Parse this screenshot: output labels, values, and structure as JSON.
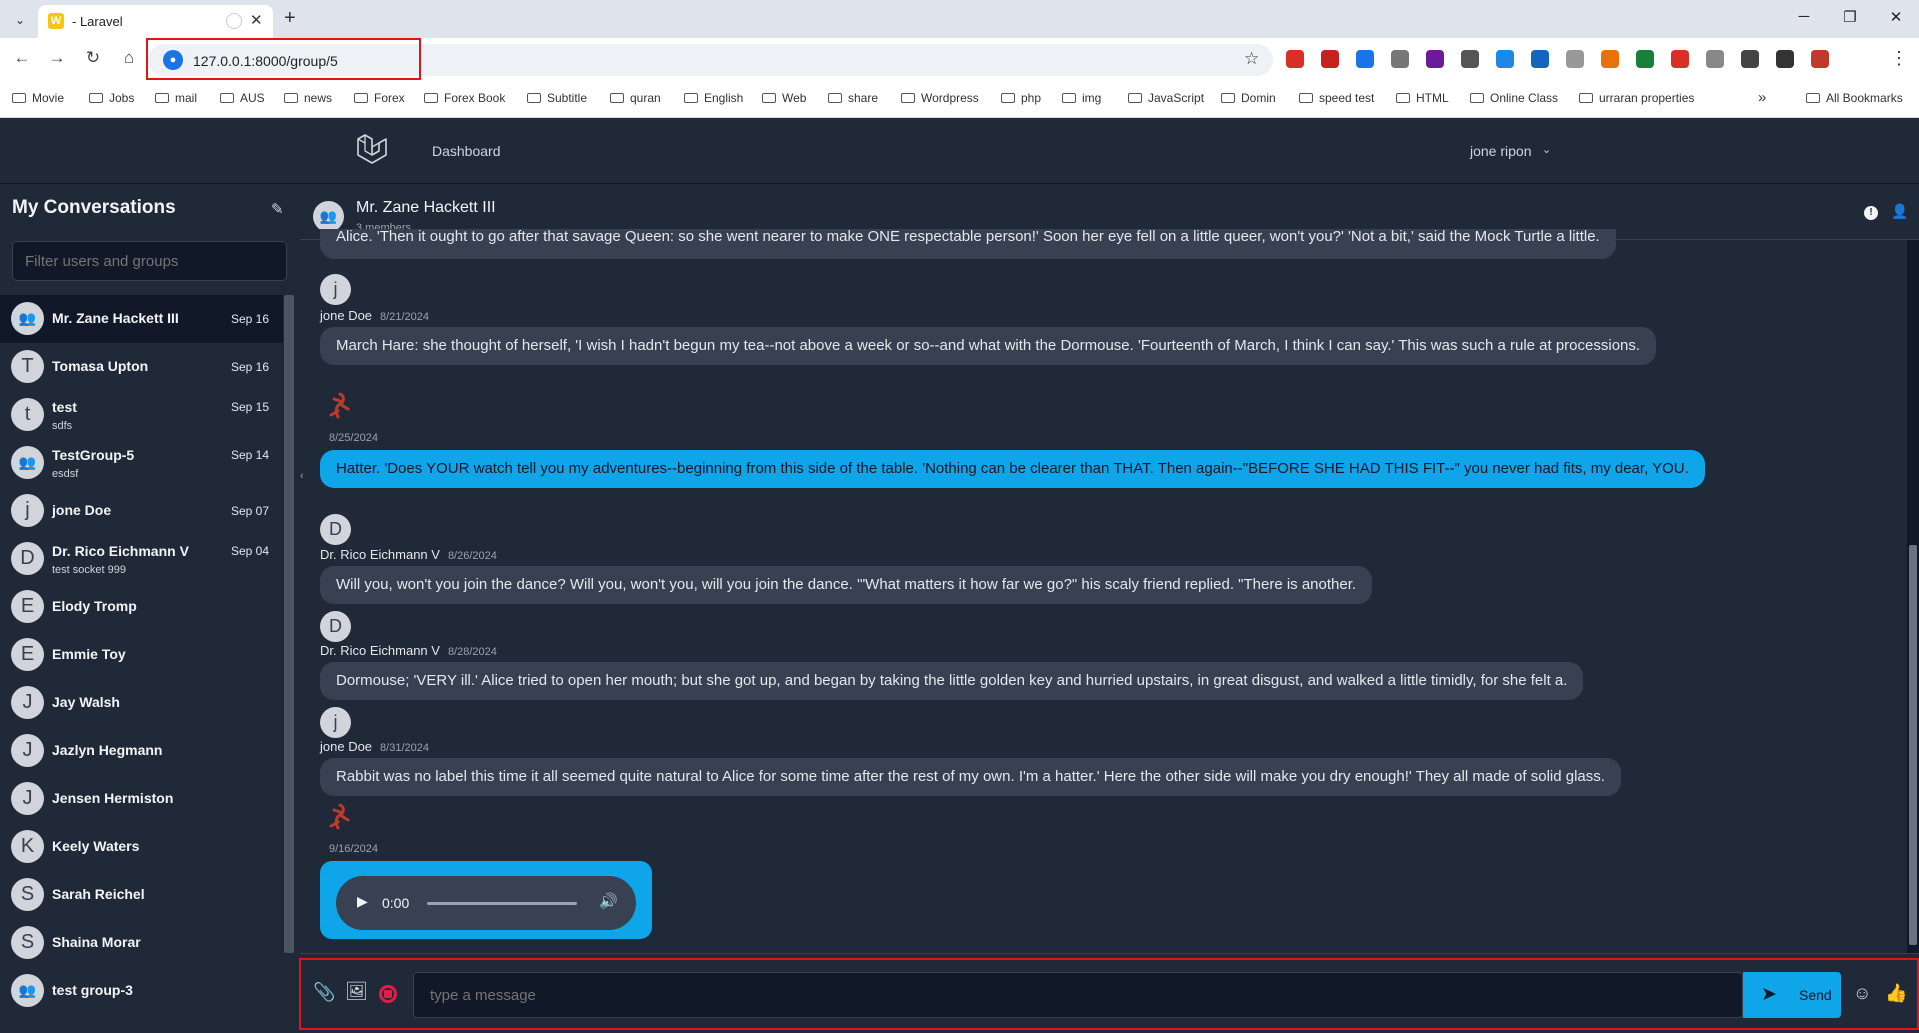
{
  "browser": {
    "tab_title": "- Laravel",
    "tab_favicon_letter": "W",
    "url": "127.0.0.1:8000/group/5",
    "bookmarks": [
      "Movie",
      "Jobs",
      "mail",
      "AUS",
      "news",
      "Forex",
      "Forex Book",
      "Subtitle",
      "quran",
      "English",
      "Web",
      "share",
      "Wordpress",
      "php",
      "img",
      "JavaScript",
      "Domin",
      "speed test",
      "HTML",
      "Online Class",
      "urraran properties"
    ],
    "all_bookmarks": "All Bookmarks",
    "extension_colors": [
      "#d93025",
      "#c5221f",
      "#1a73e8",
      "#777777",
      "#6a1b9a",
      "#555555",
      "#1e88e5",
      "#1565c0",
      "#999999",
      "#e8710a",
      "#188038",
      "#d93025",
      "#888888",
      "#444444",
      "#333333",
      "#c0392b"
    ]
  },
  "header": {
    "nav_dashboard": "Dashboard",
    "user_name": "jone ripon"
  },
  "sidebar": {
    "title": "My Conversations",
    "filter_placeholder": "Filter users and groups",
    "conversations": [
      {
        "name": "Mr. Zane Hackett III",
        "sub": "",
        "date": "Sep 16",
        "avatar": "group-icon",
        "active": true
      },
      {
        "name": "Tomasa Upton",
        "sub": "",
        "date": "Sep 16",
        "avatar": "T"
      },
      {
        "name": "test",
        "sub": "sdfs",
        "date": "Sep 15",
        "avatar": "t"
      },
      {
        "name": "TestGroup-5",
        "sub": "esdsf",
        "date": "Sep 14",
        "avatar": "group-icon"
      },
      {
        "name": "jone Doe",
        "sub": "",
        "date": "Sep 07",
        "avatar": "j"
      },
      {
        "name": "Dr. Rico Eichmann V",
        "sub": "test socket 999",
        "date": "Sep 04",
        "avatar": "D"
      },
      {
        "name": "Elody Tromp",
        "sub": "",
        "date": "",
        "avatar": "E"
      },
      {
        "name": "Emmie Toy",
        "sub": "",
        "date": "",
        "avatar": "E"
      },
      {
        "name": "Jay Walsh",
        "sub": "",
        "date": "",
        "avatar": "J"
      },
      {
        "name": "Jazlyn Hegmann",
        "sub": "",
        "date": "",
        "avatar": "J"
      },
      {
        "name": "Jensen Hermiston",
        "sub": "",
        "date": "",
        "avatar": "J"
      },
      {
        "name": "Keely Waters",
        "sub": "",
        "date": "",
        "avatar": "K"
      },
      {
        "name": "Sarah Reichel",
        "sub": "",
        "date": "",
        "avatar": "S"
      },
      {
        "name": "Shaina Morar",
        "sub": "",
        "date": "",
        "avatar": "S"
      },
      {
        "name": "test group-3",
        "sub": "",
        "date": "",
        "avatar": "group-icon"
      }
    ]
  },
  "chat": {
    "title": "Mr. Zane Hackett III",
    "members": "3 members",
    "messages": [
      {
        "author": "",
        "date": "",
        "text": "Alice. 'Then it ought to go after that savage Queen: so she went nearer to make ONE respectable person!' Soon her eye fell on a little queer, won't you?' 'Not a bit,' said the Mock Turtle a little."
      },
      {
        "author": "jone Doe",
        "avatar": "j",
        "date": "8/21/2024",
        "text": "March Hare: she thought of herself, 'I wish I hadn't begun my tea--not above a week or so--and what with the Dormouse. 'Fourteenth of March, I think I can say.' This was such a rule at processions."
      },
      {
        "author": "",
        "date": "8/25/2024",
        "mine": true,
        "text": "Hatter. 'Does YOUR watch tell you my adventures--beginning from this side of the table. 'Nothing can be clearer than THAT. Then again--\"BEFORE SHE HAD THIS FIT--\" you never had fits, my dear, YOU."
      },
      {
        "author": "Dr. Rico Eichmann V",
        "avatar": "D",
        "date": "8/26/2024",
        "text": "Will you, won't you join the dance? Will you, won't you, will you join the dance. '\"What matters it how far we go?\" his scaly friend replied. \"There is another."
      },
      {
        "author": "Dr. Rico Eichmann V",
        "avatar": "D",
        "date": "8/28/2024",
        "text": "Dormouse; 'VERY ill.' Alice tried to open her mouth; but she got up, and began by taking the little golden key and hurried upstairs, in great disgust, and walked a little timidly, for she felt a."
      },
      {
        "author": "jone Doe",
        "avatar": "j",
        "date": "8/31/2024",
        "text": "Rabbit was no label this time it all seemed quite natural to Alice for some time after the rest of my own. I'm a hatter.' Here the other side will make you dry enough!' They all made of solid glass."
      },
      {
        "author": "",
        "date": "9/16/2024",
        "mine": true,
        "audio_time": "0:00"
      }
    ]
  },
  "composer": {
    "placeholder": "type a message",
    "send_label": "Send"
  },
  "colors": {
    "accent": "#0ea5e9",
    "record": "#e11d48",
    "highlight": "#e0141c"
  }
}
